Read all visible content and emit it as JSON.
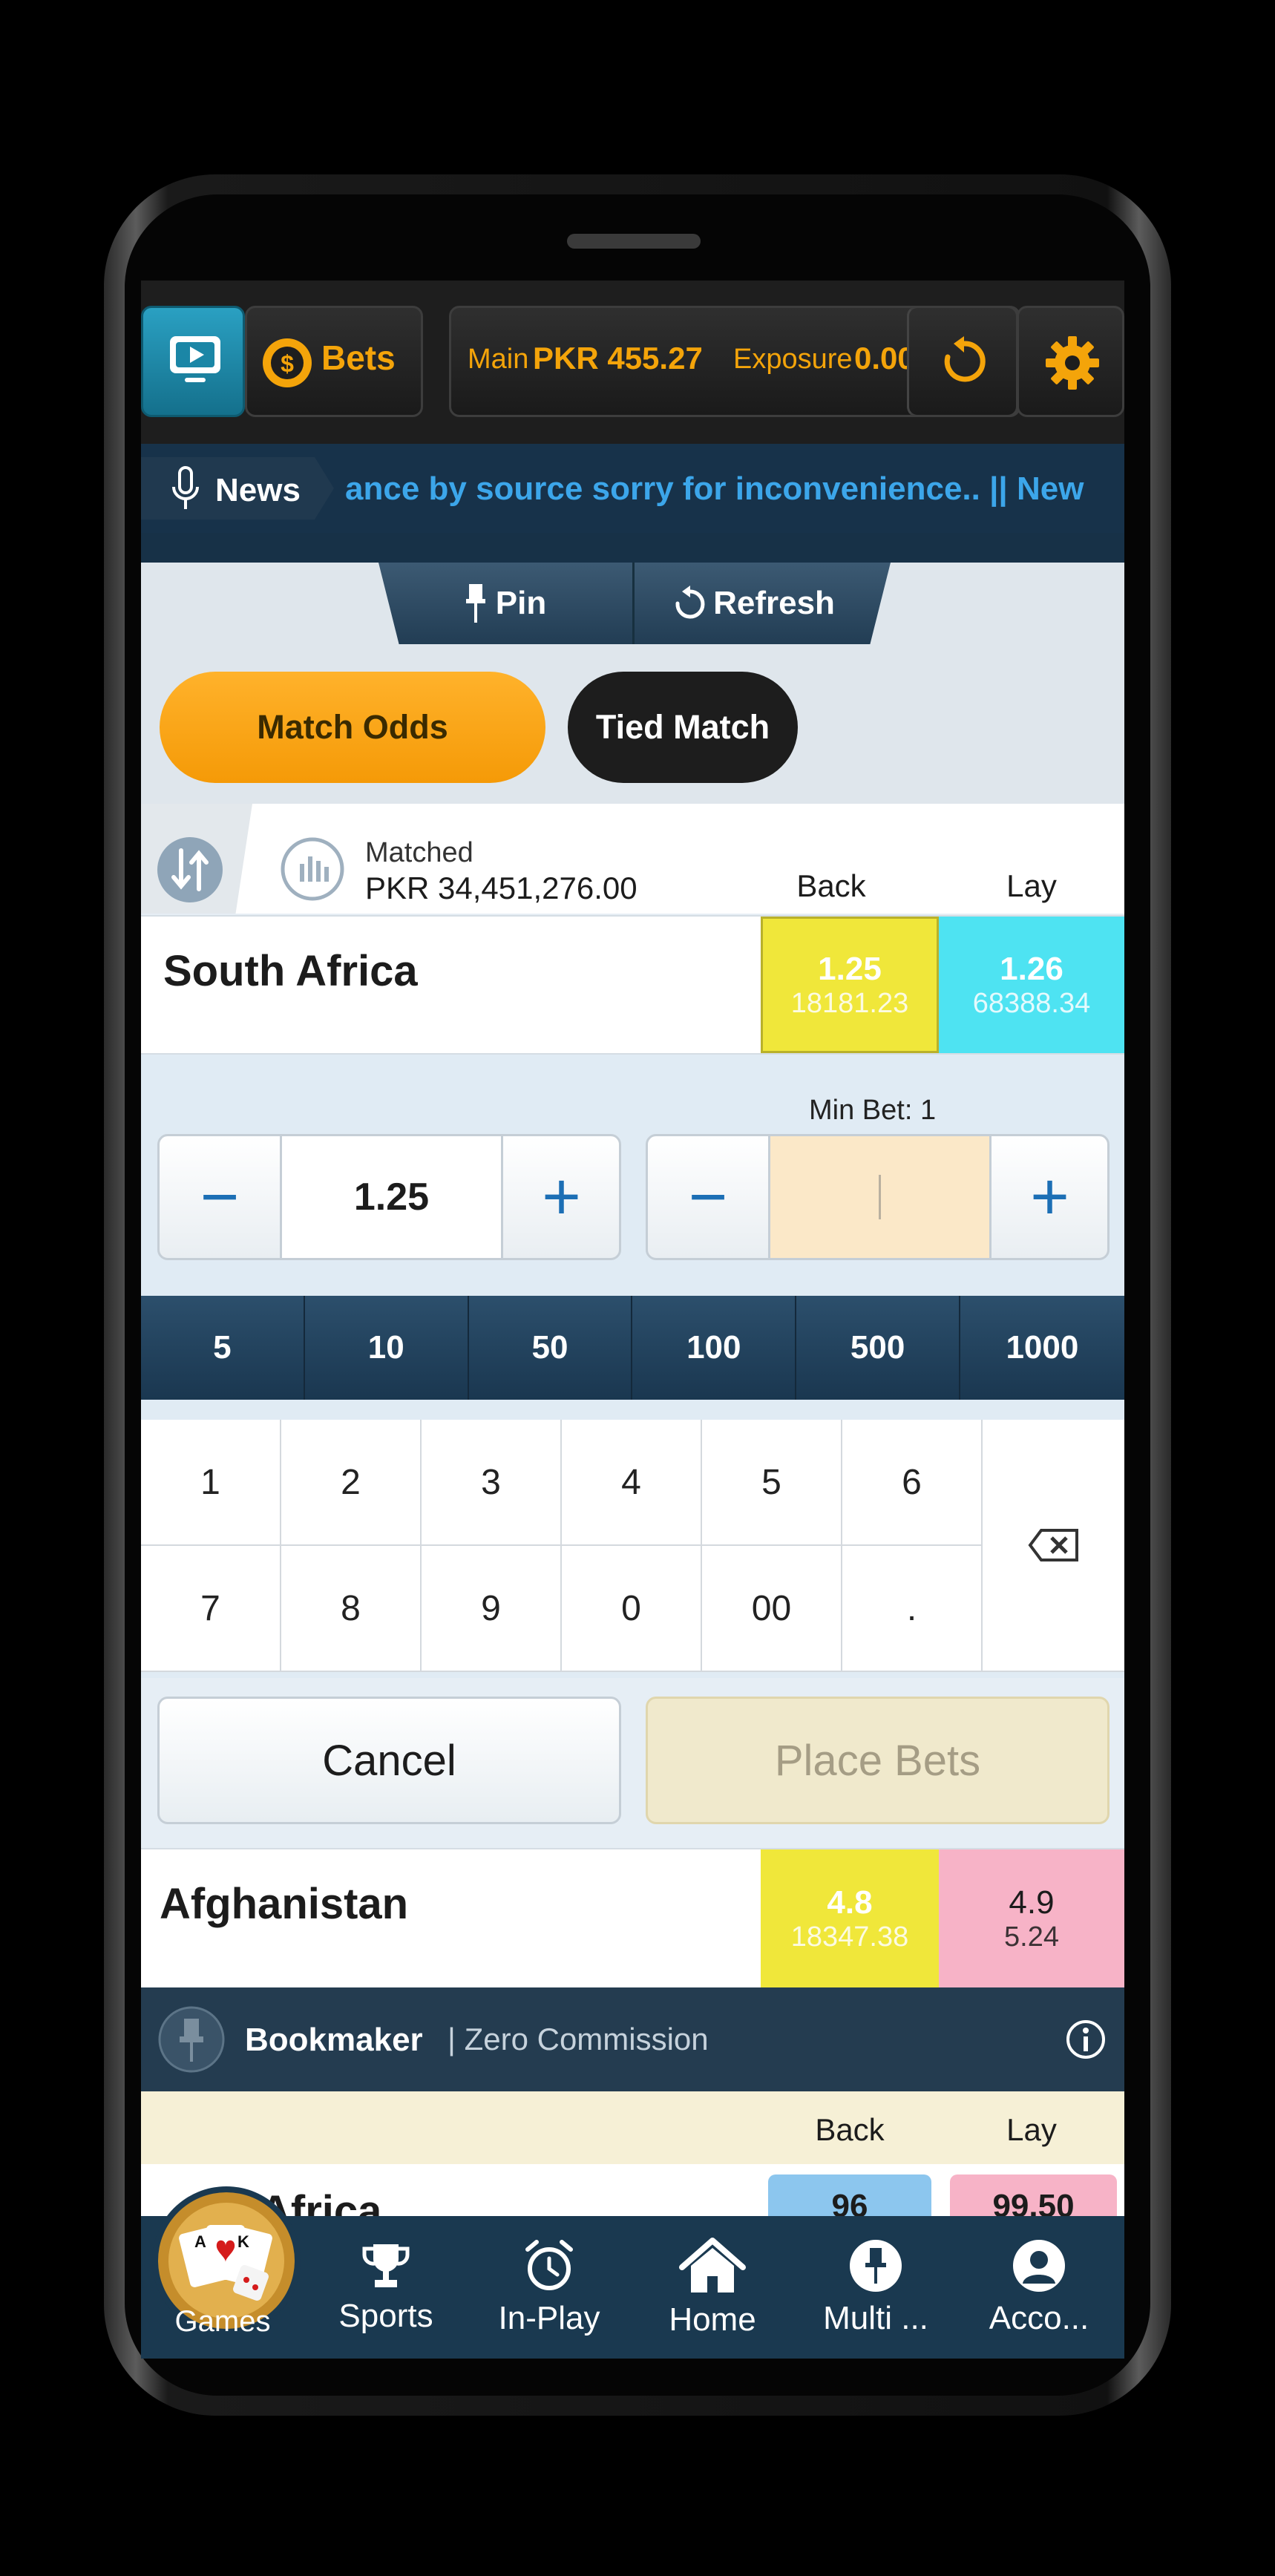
{
  "topbar": {
    "bets_label": "Bets",
    "main_label": "Main",
    "main_value": "PKR 455.27",
    "exposure_label": "Exposure",
    "exposure_value": "0.00"
  },
  "news": {
    "label": "News",
    "ticker": "ance by source sorry for inconvenience.. || New"
  },
  "toolbar": {
    "pin_label": "Pin",
    "refresh_label": "Refresh"
  },
  "market_tabs": [
    {
      "label": "Match Odds",
      "active": true
    },
    {
      "label": "Tied Match",
      "active": false
    }
  ],
  "market_header": {
    "matched_label": "Matched",
    "matched_value": "PKR 34,451,276.00",
    "back_label": "Back",
    "lay_label": "Lay"
  },
  "runners": [
    {
      "name": "South Africa",
      "back_price": "1.25",
      "back_size": "18181.23",
      "lay_price": "1.26",
      "lay_size": "68388.34"
    },
    {
      "name": "Afghanistan",
      "back_price": "4.8",
      "back_size": "18347.38",
      "lay_price": "4.9",
      "lay_size": "5.24"
    }
  ],
  "betslip": {
    "min_bet_label": "Min Bet:",
    "min_bet_value": "1",
    "odds_value": "1.25",
    "minus": "−",
    "plus": "+",
    "stake_value": "",
    "chips": [
      "5",
      "10",
      "50",
      "100",
      "500",
      "1000"
    ],
    "keys": [
      "1",
      "2",
      "3",
      "4",
      "5",
      "6",
      "7",
      "8",
      "9",
      "0",
      "00",
      "."
    ],
    "cancel_label": "Cancel",
    "place_label": "Place Bets"
  },
  "bookmaker": {
    "title": "Bookmaker",
    "subtitle": "| Zero Commission",
    "back_label": "Back",
    "lay_label": "Lay",
    "partial_runner": "Africa",
    "back_partial": "96",
    "lay_partial": "99.50"
  },
  "bottom_nav": [
    {
      "label": "Games",
      "icon": "games-icon"
    },
    {
      "label": "Sports",
      "icon": "trophy-icon"
    },
    {
      "label": "In-Play",
      "icon": "clock-icon"
    },
    {
      "label": "Home",
      "icon": "home-icon"
    },
    {
      "label": "Multi ...",
      "icon": "pin-icon"
    },
    {
      "label": "Acco...",
      "icon": "user-icon"
    }
  ],
  "colors": {
    "back": "#f0e73a",
    "lay_blue": "#4ee3f2",
    "lay_pink": "#f7b3c7",
    "accent_orange": "#ffa10a",
    "gold": "#f4a40a"
  }
}
